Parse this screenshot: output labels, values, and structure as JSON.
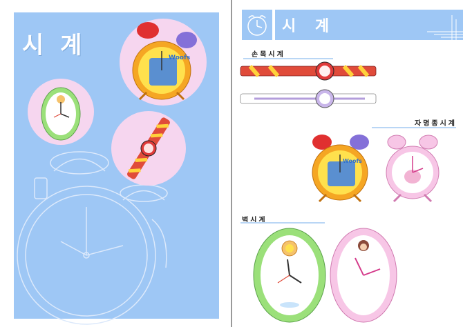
{
  "left_page": {
    "title": "시 계"
  },
  "right_page": {
    "header_title": "시 계",
    "sections": [
      {
        "id": "wristwatch",
        "label": "손목시계"
      },
      {
        "id": "alarm",
        "label": "자명종시계"
      },
      {
        "id": "wall",
        "label": "벽시계"
      }
    ]
  },
  "colors": {
    "panel_blue": "#9ec7f5",
    "pink_circle": "#f6d6ef",
    "orange_frame": "#f5a623",
    "green_frame": "#9be07a",
    "pink_frame": "#f7c6e6",
    "red_bell": "#e03030",
    "purple_bell": "#8470d8"
  },
  "icons": [
    "alarm-clock-icon"
  ]
}
